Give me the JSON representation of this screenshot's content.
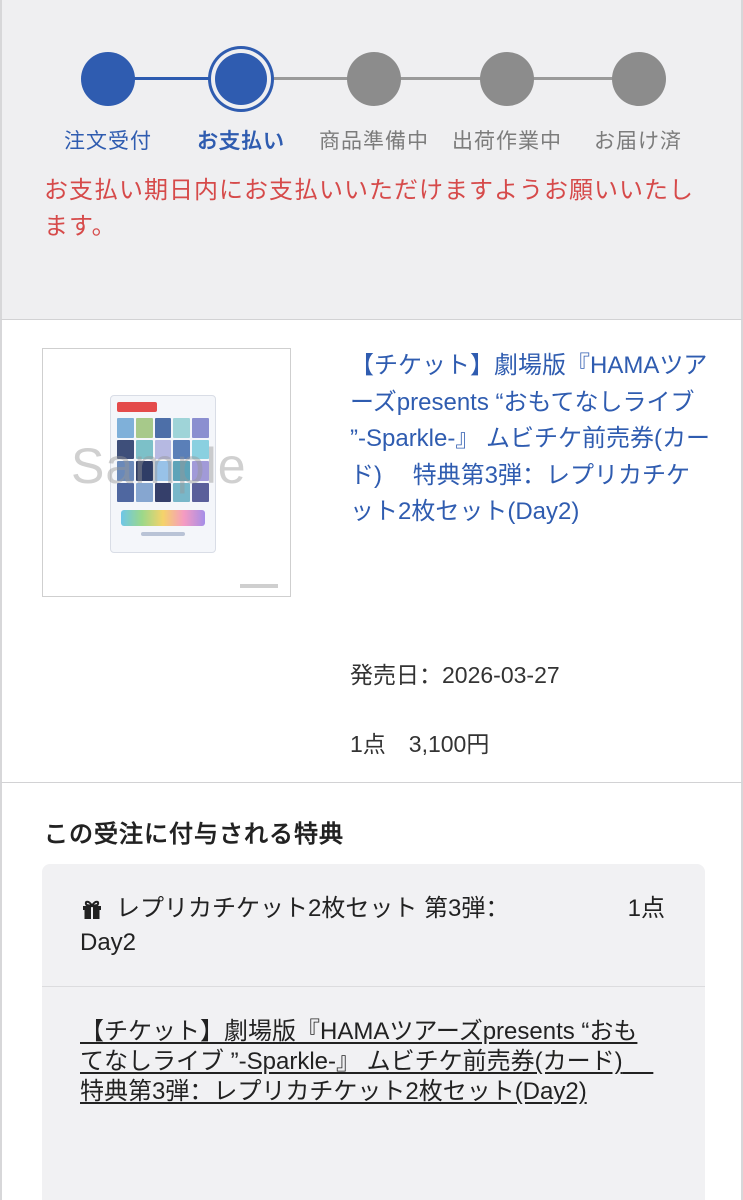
{
  "order_status": {
    "steps": [
      {
        "label": "注文受付",
        "state": "done"
      },
      {
        "label": "お支払い",
        "state": "current"
      },
      {
        "label": "商品準備中",
        "state": "pending"
      },
      {
        "label": "出荷作業中",
        "state": "pending"
      },
      {
        "label": "お届け済",
        "state": "pending"
      }
    ],
    "notice": "お支払い期日内にお支払いいただけますようお願いいたします。",
    "colors": {
      "active": "#2f5cb0",
      "inactive": "#8c8c8c",
      "notice": "#d64a4a"
    }
  },
  "product": {
    "image_watermark": "Sample",
    "title": "【チケット】劇場版『HAMAツアーズpresents “おもてなしライブ ”-Sparkle-』 ムビチケ前売券(カード)　 特典第3弾：レプリカチケット2枚セット(Day2)",
    "release_date": "発売日：2026-03-27",
    "quantity_price": "1点　3,100円"
  },
  "bonus": {
    "heading": "この受注に付与される特典",
    "item_icon": "gift-icon",
    "item_name": "レプリカチケット2枚セット 第3弾：Day2",
    "item_qty": "1点",
    "link_text": "【チケット】劇場版『HAMAツアーズpresents “おもてなしライブ ”-Sparkle-』 ムビチケ前売券(カード)　 特典第3弾：レプリカチケット2枚セット(Day2)"
  }
}
